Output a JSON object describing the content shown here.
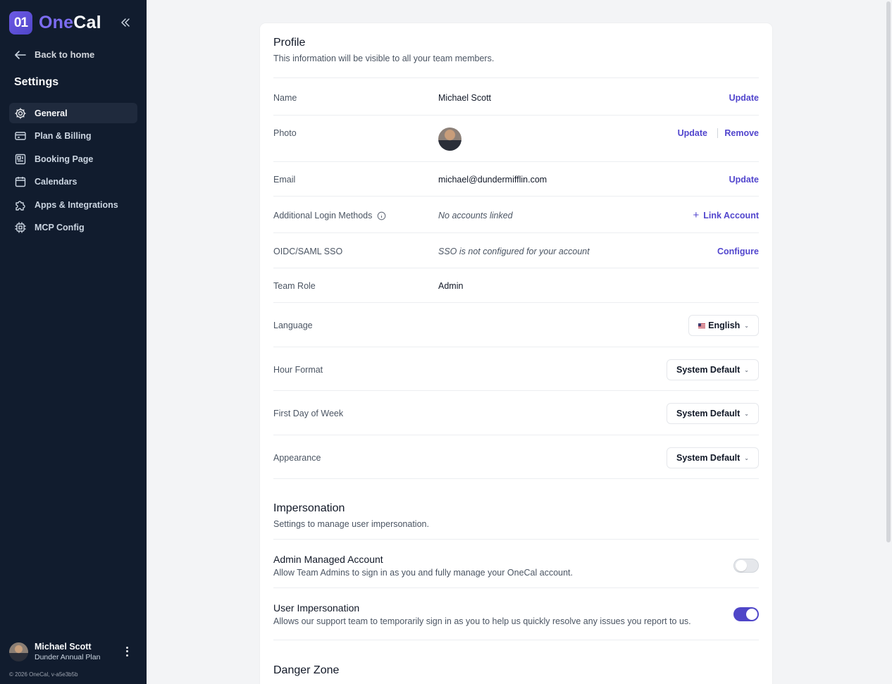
{
  "app": {
    "logo_mark": "01",
    "logo_one": "One",
    "logo_cal": "Cal"
  },
  "sidebar": {
    "back_label": "Back to home",
    "title": "Settings",
    "items": [
      {
        "label": "General",
        "icon": "gear-icon",
        "active": true
      },
      {
        "label": "Plan & Billing",
        "icon": "credit-card-icon"
      },
      {
        "label": "Booking Page",
        "icon": "booking-page-icon"
      },
      {
        "label": "Calendars",
        "icon": "calendar-icon"
      },
      {
        "label": "Apps & Integrations",
        "icon": "puzzle-icon"
      },
      {
        "label": "MCP Config",
        "icon": "chip-icon"
      }
    ],
    "user": {
      "name": "Michael Scott",
      "plan": "Dunder Annual Plan"
    },
    "footer": "© 2026 OneCal, v-a5e3b5b"
  },
  "profile": {
    "title": "Profile",
    "subtitle": "This information will be visible to all your team members.",
    "name": {
      "label": "Name",
      "value": "Michael Scott",
      "action": "Update"
    },
    "photo": {
      "label": "Photo",
      "update": "Update",
      "remove": "Remove"
    },
    "email": {
      "label": "Email",
      "value": "michael@dundermifflin.com",
      "action": "Update"
    },
    "login_methods": {
      "label": "Additional Login Methods",
      "value": "No accounts linked",
      "action": "Link Account"
    },
    "sso": {
      "label": "OIDC/SAML SSO",
      "value": "SSO is not configured for your account",
      "action": "Configure"
    },
    "team_role": {
      "label": "Team Role",
      "value": "Admin"
    },
    "language": {
      "label": "Language",
      "value": "English"
    },
    "hour_format": {
      "label": "Hour Format",
      "value": "System Default"
    },
    "first_day": {
      "label": "First Day of Week",
      "value": "System Default"
    },
    "appearance": {
      "label": "Appearance",
      "value": "System Default"
    }
  },
  "impersonation": {
    "title": "Impersonation",
    "subtitle": "Settings to manage user impersonation.",
    "admin_managed": {
      "title": "Admin Managed Account",
      "desc": "Allow Team Admins to sign in as you and fully manage your OneCal account.",
      "enabled": false
    },
    "user_impersonation": {
      "title": "User Impersonation",
      "desc": "Allows our support team to temporarily sign in as you to help us quickly resolve any issues you report to us.",
      "enabled": true
    }
  },
  "danger_zone": {
    "title": "Danger Zone"
  },
  "colors": {
    "sidebar_bg": "#111c2e",
    "accent": "#5145cd",
    "toggle_on": "#4f46c8"
  }
}
